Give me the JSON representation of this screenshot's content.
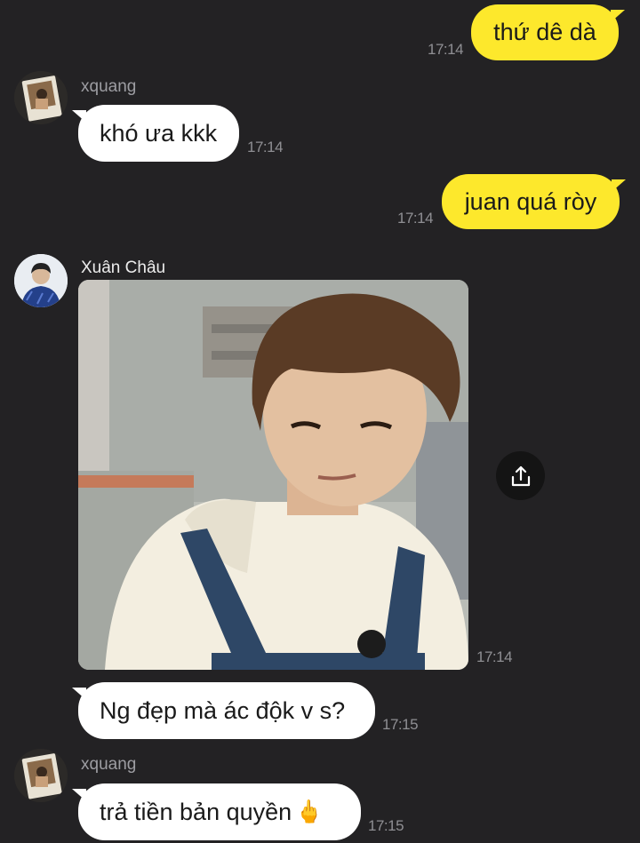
{
  "messages": [
    {
      "side": "out",
      "text": "thứ dê dà",
      "time": "17:14"
    },
    {
      "side": "in",
      "sender": "xquang",
      "text": "khó ưa kkk",
      "time": "17:14"
    },
    {
      "side": "out",
      "text": "juan quá ròy",
      "time": "17:14"
    },
    {
      "side": "in",
      "sender": "Xuân Châu",
      "type": "photo",
      "time": "17:14",
      "action_icon": "share-icon"
    },
    {
      "side": "in",
      "sender": "Xuân Châu",
      "text": "Ng đẹp mà ác độk v s?",
      "time": "17:15"
    },
    {
      "side": "in",
      "sender": "xquang",
      "text": "trả tiền bản quyền",
      "emoji": "🖕",
      "time": "17:15"
    }
  ],
  "colors": {
    "background": "#232224",
    "outgoing_bubble": "#fde82c",
    "incoming_bubble": "#ffffff",
    "timestamp": "#8f8f93"
  }
}
